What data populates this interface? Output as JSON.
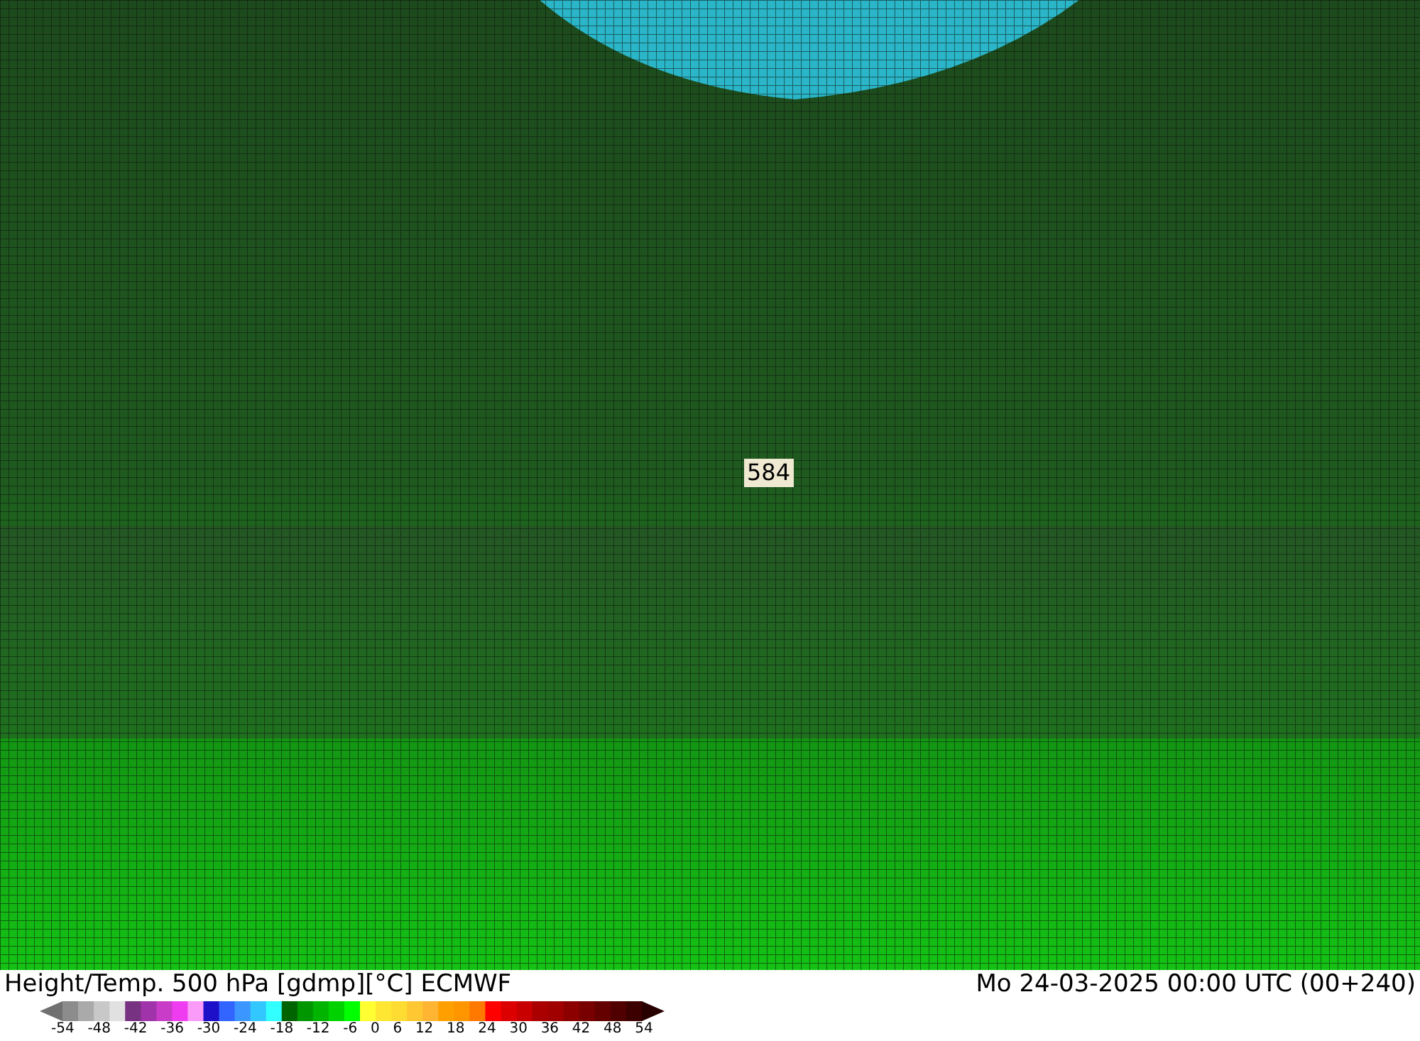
{
  "map": {
    "contour_label": "584"
  },
  "footer": {
    "title": "Height/Temp. 500 hPa [gdmp][°C] ECMWF",
    "valid_time": "Mo 24-03-2025 00:00 UTC (00+240)"
  },
  "legend": {
    "ticks": [
      "-54",
      "-48",
      "-42",
      "-36",
      "-30",
      "-24",
      "-18",
      "-12",
      "-6",
      "0",
      "6",
      "12",
      "18",
      "24",
      "30",
      "36",
      "42",
      "48",
      "54"
    ]
  }
}
